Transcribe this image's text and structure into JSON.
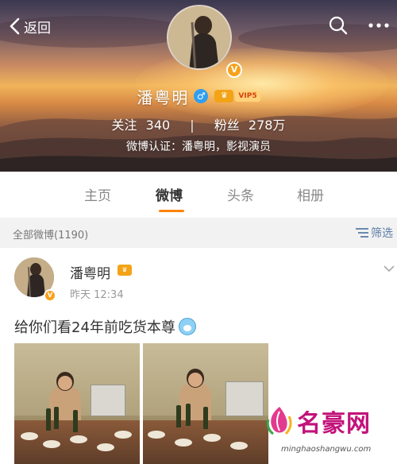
{
  "topbar": {
    "back_label": "返回"
  },
  "profile": {
    "name": "潘粤明",
    "gender_symbol": "♂",
    "vip_level": "VIP5",
    "verified_badge": "V",
    "following_label": "关注",
    "following_count": "340",
    "followers_label": "粉丝",
    "followers_count": "278万",
    "verification": "微博认证：潘粤明，影视演员"
  },
  "tabs": [
    {
      "label": "主页",
      "active": false
    },
    {
      "label": "微博",
      "active": true
    },
    {
      "label": "头条",
      "active": false
    },
    {
      "label": "相册",
      "active": false
    }
  ],
  "filterbar": {
    "count_label": "全部微博(1190)",
    "filter_label": "筛选"
  },
  "post": {
    "author": "潘粤明",
    "time": "昨天 12:34",
    "text": "给你们看24年前吃货本尊",
    "photo_count": 2
  },
  "watermark": {
    "brand": "名豪网",
    "url": "minghaoshangwu.com"
  },
  "colors": {
    "accent_orange": "#ff8200",
    "link_blue": "#5a7ea8",
    "badge_orange": "#f7a21b",
    "watermark_magenta": "#c2127a"
  }
}
